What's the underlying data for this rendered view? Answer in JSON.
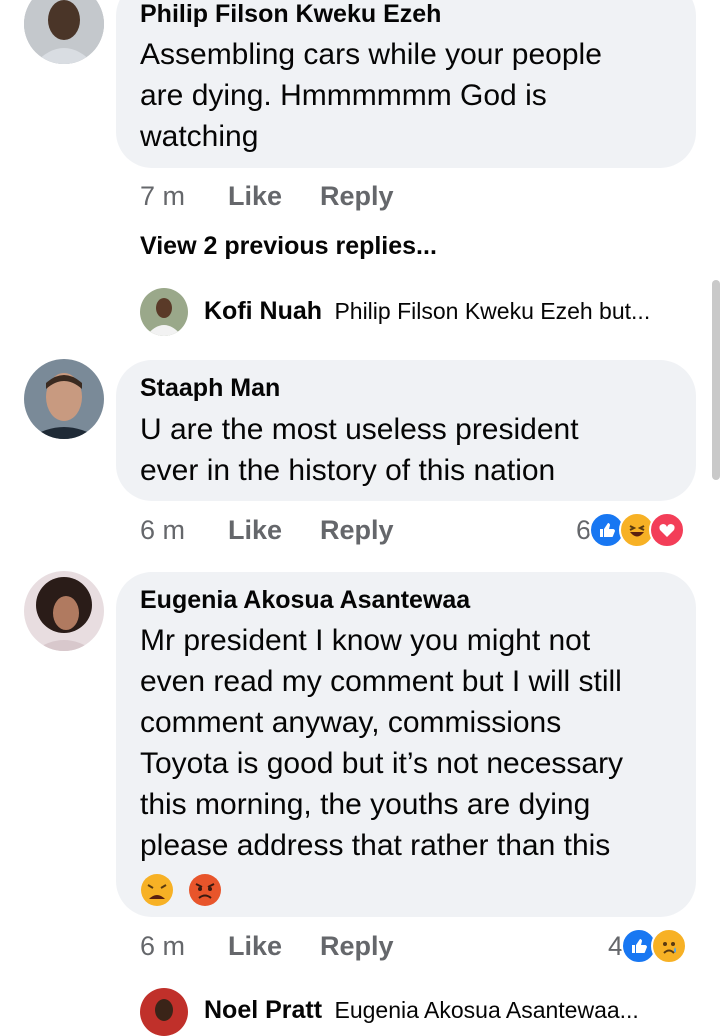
{
  "comments": [
    {
      "author": "Philip Filson Kweku Ezeh",
      "lines": [
        "Assembling cars while your people",
        "are dying. Hmmmmmm God is",
        "watching"
      ],
      "time": "7 m",
      "like": "Like",
      "reply": "Reply"
    },
    {
      "author": "Staaph Man",
      "lines": [
        "U are the most useless president",
        "ever in the history of this nation"
      ],
      "time": "6 m",
      "like": "Like",
      "reply": "Reply",
      "reaction_count": "6",
      "reactions": [
        "like-icon",
        "haha-icon",
        "love-icon"
      ]
    },
    {
      "author": "Eugenia Akosua Asantewaa",
      "lines": [
        "Mr president I know you might not",
        "even read my comment  but I will still",
        "comment anyway, commissions",
        "Toyota is good but it’s  not necessary",
        "this morning, the youths are dying",
        "please address that rather than this"
      ],
      "emojis": [
        "weary-face-icon",
        "angry-face-icon"
      ],
      "time": "6 m",
      "like": "Like",
      "reply": "Reply",
      "reaction_count": "4",
      "reactions": [
        "like-icon",
        "sad-icon"
      ]
    }
  ],
  "view_previous": "View 2 previous replies...",
  "replies": [
    {
      "author": "Kofi Nuah",
      "text": "Philip Filson Kweku Ezeh but..."
    },
    {
      "author": "Noel Pratt",
      "text": "Eugenia Akosua Asantewaa..."
    }
  ],
  "colors": {
    "bubble": "#f0f2f5",
    "meta": "#65676b",
    "like_blue": "#1877f2",
    "love_red": "#f33e58",
    "emoji_yellow": "#f7b125"
  }
}
